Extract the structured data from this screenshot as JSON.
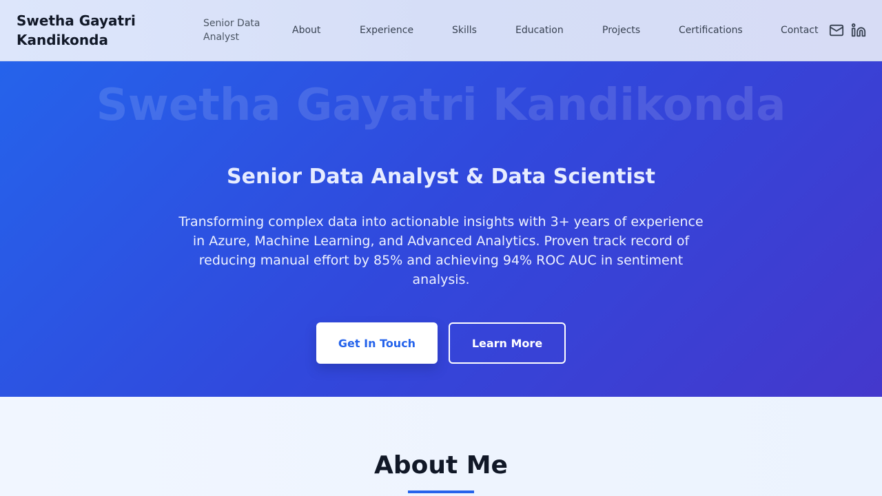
{
  "nav": {
    "brand": "Swetha Gayatri Kandikonda",
    "subtitle": "Senior Data Analyst",
    "links": [
      "About",
      "Experience",
      "Skills",
      "Education",
      "Projects",
      "Certifications",
      "Contact"
    ],
    "icons": [
      "mail-icon",
      "linkedin-icon"
    ]
  },
  "hero": {
    "background_name": "Swetha Gayatri Kandikonda",
    "title": "Senior Data Analyst & Data Scientist",
    "description": "Transforming complex data into actionable insights with 3+ years of experience in Azure, Machine Learning, and Advanced Analytics. Proven track record of reducing manual effort by 85% and achieving 94% ROC AUC in sentiment analysis.",
    "primary_button": "Get In Touch",
    "secondary_button": "Learn More"
  },
  "about": {
    "title": "About Me"
  },
  "colors": {
    "accent": "#2563eb",
    "hero_start": "#2563eb",
    "hero_end": "#4438cc"
  }
}
